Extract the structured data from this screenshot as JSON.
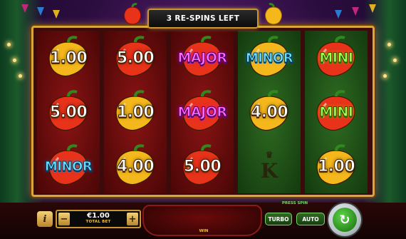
{
  "banner": {
    "text": "3 RE-SPINS LEFT"
  },
  "reels": [
    {
      "bg": "red",
      "cells": [
        {
          "kind": "value",
          "label": "1.00",
          "pepper": "#f5b81c"
        },
        {
          "kind": "value",
          "label": "5.00",
          "pepper": "#e8321a"
        },
        {
          "kind": "minor",
          "label": "MINOR",
          "pepper": "#e8321a"
        }
      ]
    },
    {
      "bg": "red",
      "cells": [
        {
          "kind": "value",
          "label": "5.00",
          "pepper": "#e8321a"
        },
        {
          "kind": "value",
          "label": "1.00",
          "pepper": "#f5b81c"
        },
        {
          "kind": "value",
          "label": "4.00",
          "pepper": "#f5b81c"
        }
      ]
    },
    {
      "bg": "red",
      "cells": [
        {
          "kind": "major",
          "label": "MAJOR",
          "pepper": "#e8321a"
        },
        {
          "kind": "major",
          "label": "MAJOR",
          "pepper": "#e8321a"
        },
        {
          "kind": "value",
          "label": "5.00",
          "pepper": "#e8321a"
        }
      ]
    },
    {
      "bg": "green",
      "cells": [
        {
          "kind": "minor",
          "label": "MINOR",
          "pepper": "#f5b81c"
        },
        {
          "kind": "value",
          "label": "4.00",
          "pepper": "#f5b81c"
        },
        {
          "kind": "king",
          "label": "K",
          "pepper": ""
        }
      ]
    },
    {
      "bg": "green",
      "cells": [
        {
          "kind": "mini",
          "label": "MINI",
          "pepper": "#e8321a"
        },
        {
          "kind": "mini",
          "label": "MINI",
          "pepper": "#e8321a"
        },
        {
          "kind": "value",
          "label": "1.00",
          "pepper": "#f5b81c"
        }
      ]
    }
  ],
  "controls": {
    "info_label": "i",
    "minus_label": "−",
    "plus_label": "+",
    "bet_value": "€1.00",
    "bet_label": "TOTAL BET",
    "win_label": "WIN",
    "press_spin": "PRESS SPIN",
    "turbo_label": "TURBO",
    "auto_label": "AUTO",
    "spin_icon": "↻"
  },
  "colors": {
    "frame_gold": "#d8a63a",
    "red_reel": "#8a1414",
    "green_reel": "#2f6b22",
    "major": "#ff6bff",
    "minor": "#6fe1ff",
    "mini": "#a6ff4a"
  }
}
